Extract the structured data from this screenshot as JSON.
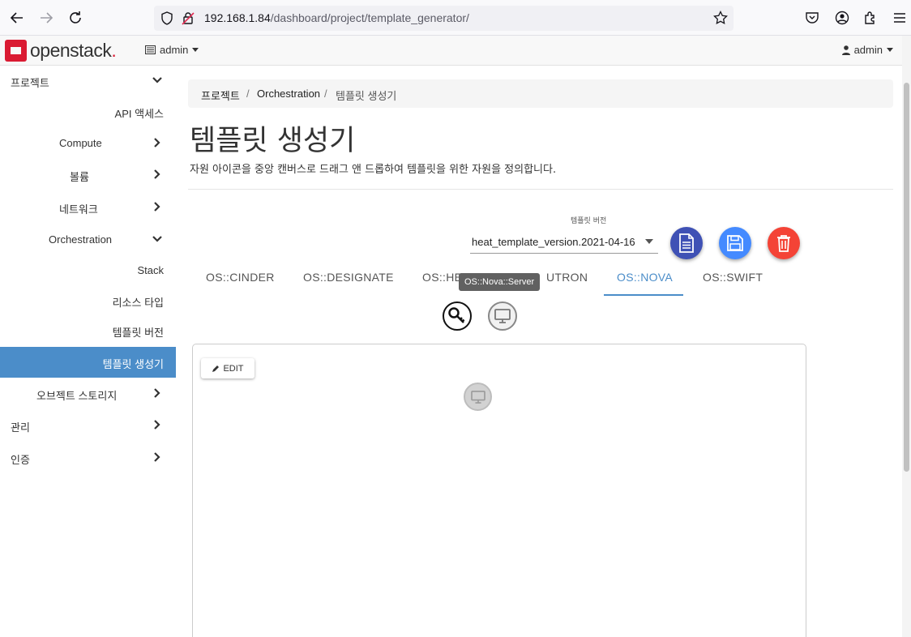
{
  "browser": {
    "url_host": "192.168.1.84",
    "url_path": "/dashboard/project/template_generator/"
  },
  "navbar": {
    "logo_text": "openstack",
    "logo_dot": ".",
    "project_menu": "admin",
    "user_menu": "admin"
  },
  "sidebar": {
    "project": "프로젝트",
    "api_access": "API 액세스",
    "compute": "Compute",
    "volume": "볼륨",
    "network": "네트워크",
    "orchestration": "Orchestration",
    "stack": "Stack",
    "resource_types": "리소스 타입",
    "template_versions": "템플릿 버전",
    "template_generator": "템플릿 생성기",
    "object_storage": "오브젝트 스토리지",
    "admin": "관리",
    "identity": "인증"
  },
  "breadcrumb": {
    "item1": "프로젝트",
    "item2": "Orchestration",
    "item3": "템플릿 생성기",
    "sep": "/"
  },
  "page": {
    "title": "템플릿 생성기",
    "description": "자원 아이콘을 중앙 캔버스로 드래그 앤 드롭하여 템플릿을 위한 자원을 정의합니다."
  },
  "template_version": {
    "label": "템플릿 버전",
    "value": "heat_template_version.2021-04-16"
  },
  "tabs": {
    "cinder": "OS::CINDER",
    "designate": "OS::DESIGNATE",
    "heat_partial": "OS::HE",
    "neutron_partial": "UTRON",
    "nova": "OS::NOVA",
    "swift": "OS::SWIFT"
  },
  "tooltip": "OS::Nova::Server",
  "canvas": {
    "edit_label": "EDIT"
  },
  "colors": {
    "accent": "#4b8dc9",
    "fab_doc": "#3f51b5",
    "fab_save": "#448aff",
    "fab_delete": "#f44336"
  }
}
